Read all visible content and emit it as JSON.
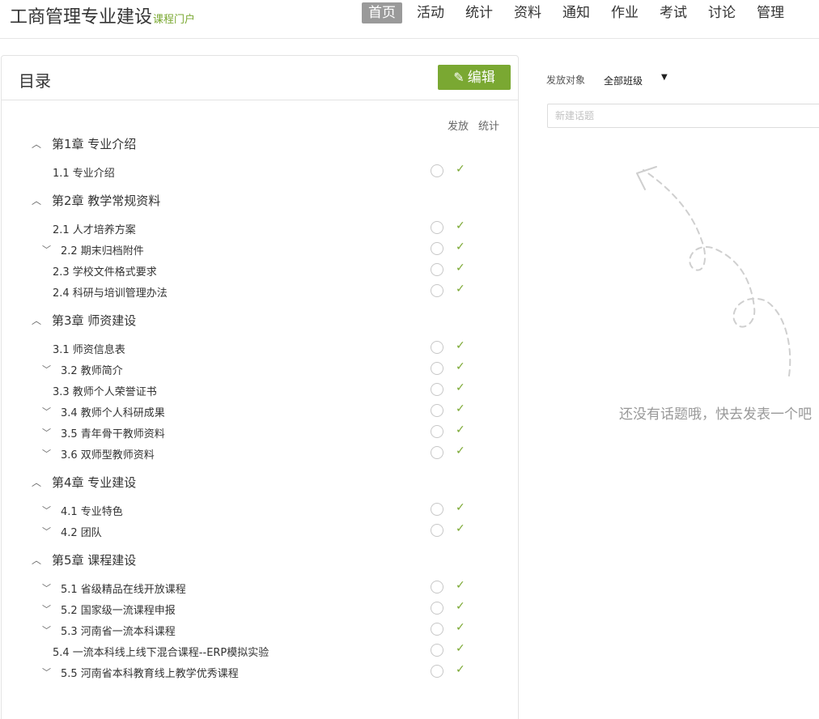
{
  "header": {
    "title": "工商管理专业建设",
    "subtitle": "课程门户",
    "nav": [
      "首页",
      "活动",
      "统计",
      "资料",
      "通知",
      "作业",
      "考试",
      "讨论",
      "管理"
    ],
    "active_nav": "首页"
  },
  "catalog": {
    "title": "目录",
    "edit_label": "编辑",
    "col_publish": "发放",
    "col_stats": "统计",
    "chapters": [
      {
        "title": "第1章 专业介绍",
        "sections": [
          {
            "label": "1.1  专业介绍",
            "expandable": false
          }
        ]
      },
      {
        "title": "第2章 教学常规资料",
        "sections": [
          {
            "label": "2.1  人才培养方案",
            "expandable": false
          },
          {
            "label": "2.2  期末归档附件",
            "expandable": true
          },
          {
            "label": "2.3  学校文件格式要求",
            "expandable": false
          },
          {
            "label": "2.4  科研与培训管理办法",
            "expandable": false
          }
        ]
      },
      {
        "title": "第3章 师资建设",
        "sections": [
          {
            "label": "3.1  师资信息表",
            "expandable": false
          },
          {
            "label": "3.2  教师简介",
            "expandable": true
          },
          {
            "label": "3.3  教师个人荣誉证书",
            "expandable": false
          },
          {
            "label": "3.4  教师个人科研成果",
            "expandable": true
          },
          {
            "label": "3.5  青年骨干教师资料",
            "expandable": true
          },
          {
            "label": "3.6  双师型教师资料",
            "expandable": true
          }
        ]
      },
      {
        "title": "第4章 专业建设",
        "sections": [
          {
            "label": "4.1  专业特色",
            "expandable": true
          },
          {
            "label": "4.2  团队",
            "expandable": true
          }
        ]
      },
      {
        "title": "第5章 课程建设",
        "sections": [
          {
            "label": "5.1  省级精品在线开放课程",
            "expandable": true
          },
          {
            "label": "5.2  国家级一流课程申报",
            "expandable": true
          },
          {
            "label": "5.3  河南省一流本科课程",
            "expandable": true
          },
          {
            "label": "5.4  一流本科线上线下混合课程--ERP模拟实验",
            "expandable": false
          },
          {
            "label": "5.5  河南省本科教育线上教学优秀课程",
            "expandable": true
          }
        ]
      }
    ]
  },
  "discussion": {
    "target_label": "发放对象",
    "target_value": "全部班级",
    "input_placeholder": "新建话题",
    "empty_text": "还没有话题哦，快去发表一个吧"
  },
  "colors": {
    "accent": "#7aa832",
    "nav_active_bg": "#9a9a9a"
  }
}
